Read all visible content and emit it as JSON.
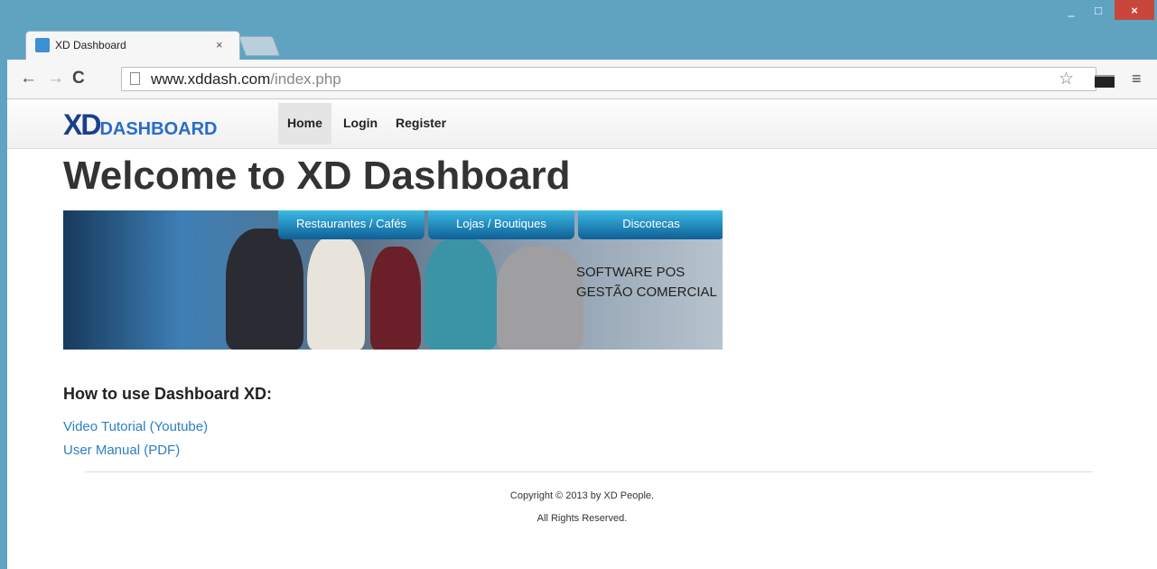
{
  "browser": {
    "tab_title": "XD Dashboard",
    "tab_close": "×",
    "url_host": "www.xddash.com",
    "url_path": "/index.php",
    "window_controls": {
      "minimize": "_",
      "maximize": "□",
      "close": "×"
    },
    "icons": {
      "back": "←",
      "forward": "→",
      "reload": "C",
      "bookmark": "☆",
      "menu": "≡"
    }
  },
  "site": {
    "logo_xd": "XD",
    "logo_text": "DASHBOARD",
    "nav": {
      "home": "Home",
      "login": "Login",
      "register": "Register"
    },
    "heading": "Welcome to XD Dashboard",
    "banner": {
      "tabs": [
        "Restaurantes / Cafés",
        "Lojas / Boutiques",
        "Discotecas"
      ],
      "slogan_line1": "SOFTWARE POS",
      "slogan_line2": "GESTÃO COMERCIAL"
    },
    "howto_heading": "How to use Dashboard XD:",
    "links": {
      "video": "Video Tutorial (Youtube)",
      "manual": "User Manual (PDF)"
    },
    "footer": {
      "copyright": "Copyright © 2013 by XD People.",
      "rights": "All Rights Reserved."
    }
  },
  "colors": {
    "titlebar": "#5fa3c1",
    "link": "#2c7fc4",
    "close": "#c9463d"
  }
}
